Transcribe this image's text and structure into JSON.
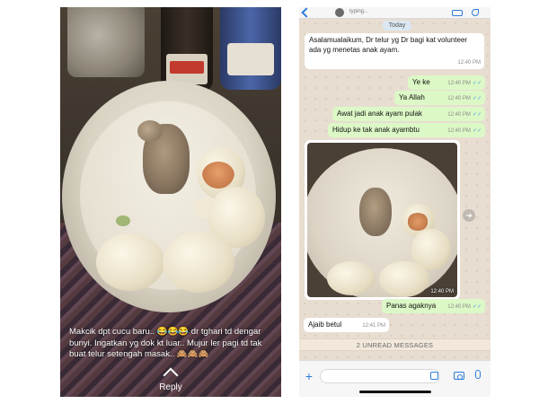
{
  "story": {
    "caption_lines": [
      "Makcik dpt cucu baru.. 😂😂😂 dr tghari td dengar",
      "bunyi. Ingatkan yg dok kt luar.. Mujur ler pagi td tak",
      "buat telur setengah masak.. 🙈🙈🙈"
    ],
    "reply_label": "Reply"
  },
  "chat": {
    "header_status": "typing...",
    "date_chip": "Today",
    "messages": [
      {
        "dir": "in",
        "text": "Asalamualaikum, Dr  telur yg Dr bagi kat volunteer ada yg menetas anak ayam.",
        "time": "12:40 PM"
      },
      {
        "dir": "out",
        "text": "Ye ke",
        "time": "12:40 PM"
      },
      {
        "dir": "out",
        "text": "Ya Allah",
        "time": "12:40 PM"
      },
      {
        "dir": "out",
        "text": "Awat jadi anak ayam pulak",
        "time": "12:40 PM"
      },
      {
        "dir": "out",
        "text": "Hidup ke tak anak ayambtu",
        "time": "12:40 PM"
      },
      {
        "dir": "out",
        "text": "Panas agaknya",
        "time": "12:40 PM"
      },
      {
        "dir": "in",
        "text": "Ajaib betul",
        "time": "12:41 PM"
      }
    ],
    "photo_time": "12:40 PM",
    "unread_banner": "2 UNREAD MESSAGES",
    "read_tick": "✓✓",
    "forward_glyph": "➔",
    "plus_glyph": "+"
  },
  "colors": {
    "incoming": "#ffffff",
    "outgoing": "#dcf8c6",
    "accent": "#2b7bd9",
    "chat_bg": "#e8ddd1"
  }
}
